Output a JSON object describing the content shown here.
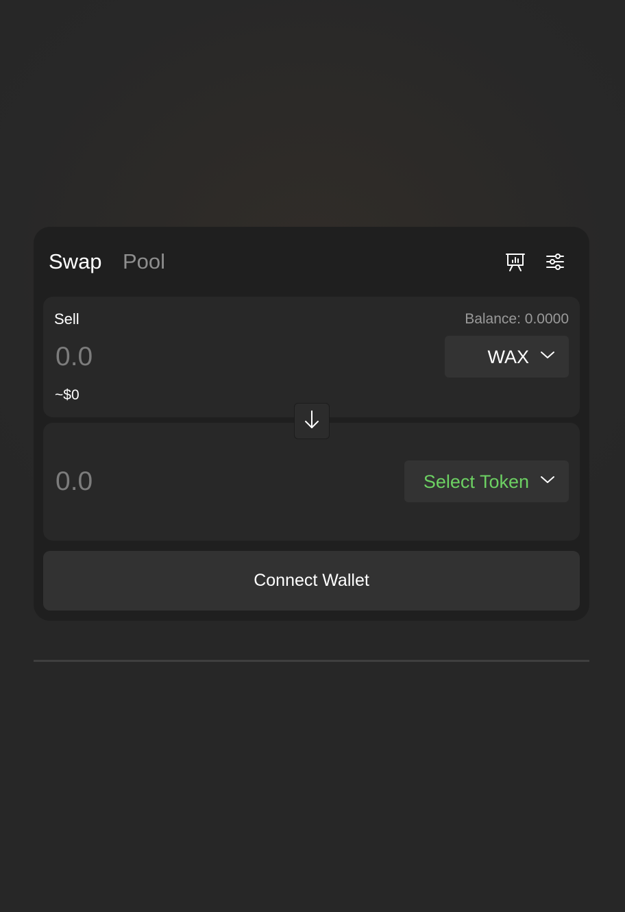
{
  "header": {
    "tabs": [
      {
        "label": "Swap",
        "active": true
      },
      {
        "label": "Pool",
        "active": false
      }
    ],
    "icons": [
      "chart-icon",
      "settings-sliders-icon"
    ]
  },
  "sell": {
    "label": "Sell",
    "balance": "Balance: 0.0000",
    "amount_placeholder": "0.0",
    "usd_value": "~$0",
    "token": "WAX"
  },
  "buy": {
    "amount_placeholder": "0.0",
    "token_button": "Select Token"
  },
  "connect_wallet_label": "Connect Wallet",
  "colors": {
    "accent_green": "#6dd163",
    "card_background": "#1f1f1f",
    "panel_background": "#282828",
    "button_background": "#323232"
  }
}
